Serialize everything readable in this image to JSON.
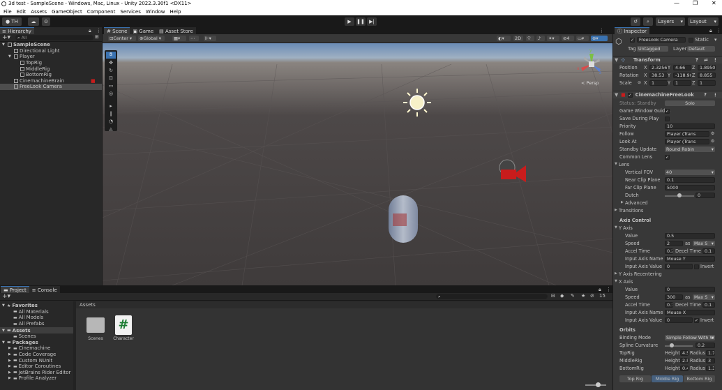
{
  "titlebar": {
    "title": "3d test - SampleScene - Windows, Mac, Linux - Unity 2022.3.30f1 <DX11>",
    "minimize": "—",
    "maximize": "❐",
    "close": "✕"
  },
  "menu": [
    "File",
    "Edit",
    "Assets",
    "GameObject",
    "Component",
    "Services",
    "Window",
    "Help"
  ],
  "toolbar": {
    "account": "TH",
    "layers": "Layers",
    "layout": "Layout"
  },
  "hierarchy": {
    "tab": "Hierarchy",
    "search_placeholder": "All",
    "items": [
      {
        "label": "SampleScene",
        "indent": 0,
        "arrow": "▼",
        "bold": true
      },
      {
        "label": "Directional Light",
        "indent": 1,
        "arrow": ""
      },
      {
        "label": "Player",
        "indent": 1,
        "arrow": "▼"
      },
      {
        "label": "TopRig",
        "indent": 2,
        "arrow": ""
      },
      {
        "label": "MiddleRig",
        "indent": 2,
        "arrow": ""
      },
      {
        "label": "BottomRig",
        "indent": 2,
        "arrow": ""
      },
      {
        "label": "CinemachineBrain",
        "indent": 1,
        "arrow": ""
      },
      {
        "label": "FreeLook Camera",
        "indent": 1,
        "arrow": "",
        "selected": true
      }
    ]
  },
  "scene": {
    "tabs": [
      "Scene",
      "Game",
      "Asset Store"
    ],
    "pivot": "Center",
    "space": "Global",
    "mode_2d": "2D",
    "persp": "< Persp",
    "axis_x": "x",
    "axis_y": "y",
    "axis_z": "z"
  },
  "project": {
    "tabs": [
      "Project",
      "Console"
    ],
    "favorites_label": "Favorites",
    "favorites": [
      "All Materials",
      "All Models",
      "All Prefabs"
    ],
    "assets_label": "Assets",
    "assets_children": [
      "Scenes"
    ],
    "packages_label": "Packages",
    "packages": [
      "Cinemachine",
      "Code Coverage",
      "Custom NUnit",
      "Editor Coroutines",
      "JetBrains Rider Editor",
      "Profile Analyzer"
    ],
    "breadcrumb": "Assets",
    "files": [
      {
        "name": "Scenes",
        "icon": "folder-icon"
      },
      {
        "name": "Character",
        "icon": "script-icon",
        "glyph": "#"
      }
    ],
    "hidden_count": "15"
  },
  "inspector": {
    "tab": "Inspector",
    "object_name": "FreeLook Camera",
    "static_label": "Static",
    "tag_label": "Tag",
    "tag_value": "Untagged",
    "layer_label": "Layer",
    "layer_value": "Default",
    "transform": {
      "title": "Transform",
      "position_label": "Position",
      "rotation_label": "Rotation",
      "scale_label": "Scale",
      "x": "X",
      "y": "Y",
      "z": "Z",
      "position": [
        "2.3256",
        "4.66",
        "1.8950"
      ],
      "rotation": [
        "38.53",
        "-118.98",
        "8.855"
      ],
      "scale": [
        "1",
        "1",
        "1"
      ]
    },
    "freelook": {
      "title": "CinemachineFreeLook",
      "status_label": "Status: Standby",
      "solo": "Solo",
      "game_window_guides": "Game Window Guides",
      "save_during_play": "Save During Play",
      "priority_label": "Priority",
      "priority": "10",
      "follow_label": "Follow",
      "follow": "Player (Trans",
      "lookat_label": "Look At",
      "lookat": "Player (Trans",
      "standby_label": "Standby Update",
      "standby": "Round Robin",
      "common_lens": "Common Lens",
      "lens_label": "Lens",
      "vfov_label": "Vertical FOV",
      "vfov": "40",
      "near_label": "Near Clip Plane",
      "near": "0.1",
      "far_label": "Far Clip Plane",
      "far": "5000",
      "dutch_label": "Dutch",
      "dutch": "0",
      "advanced_label": "Advanced",
      "transitions_label": "Transitions",
      "axis_control": "Axis Control",
      "y_axis": "Y Axis",
      "value_label": "Value",
      "speed_label": "Speed",
      "accel_label": "Accel Time",
      "decel_label": "Decel Time",
      "input_name_label": "Input Axis Name",
      "input_value_label": "Input Axis Value",
      "invert_label": "Invert",
      "as_label": "as",
      "y": {
        "value": "0.5",
        "speed": "2",
        "speed_mode": "Max S",
        "accel": "0.2",
        "decel": "0.1",
        "name": "Mouse Y",
        "input": "0"
      },
      "y_recentering": "Y Axis Recentering",
      "x_axis": "X Axis",
      "x": {
        "value": "0",
        "speed": "300",
        "speed_mode": "Max S",
        "accel": "0.1",
        "decel": "0.1",
        "name": "Mouse X",
        "input": "0"
      },
      "orbits": "Orbits",
      "binding_label": "Binding Mode",
      "binding": "Simple Follow With W",
      "spline_label": "Spline Curvature",
      "spline": "0.2",
      "height_label": "Height",
      "radius_label": "Radius",
      "rigs": [
        {
          "label": "TopRig",
          "height": "4.5",
          "radius": "1.7"
        },
        {
          "label": "MiddleRig",
          "height": "2.5",
          "radius": "3"
        },
        {
          "label": "BottomRig",
          "height": "0.4",
          "radius": "1.3"
        }
      ],
      "rig_tabs": [
        "Top Rig",
        "Middle Rig",
        "Bottom Rig"
      ]
    }
  },
  "colors": {
    "accent": "#3a72b0",
    "selection": "#2c5d87",
    "editor_bg": "#383838"
  }
}
